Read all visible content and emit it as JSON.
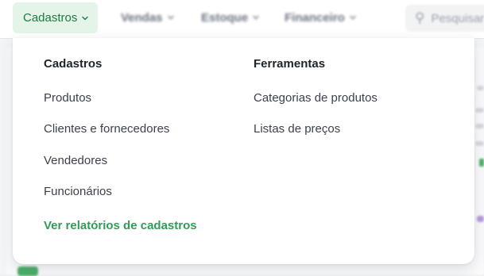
{
  "nav": {
    "items": [
      {
        "label": "Cadastros",
        "active": true
      },
      {
        "label": "Vendas",
        "active": false
      },
      {
        "label": "Estoque",
        "active": false
      },
      {
        "label": "Financeiro",
        "active": false
      }
    ],
    "search_placeholder": "Pesquisar"
  },
  "menu": {
    "col1": {
      "title": "Cadastros",
      "links": [
        "Produtos",
        "Clientes e fornecedores",
        "Vendedores",
        "Funcionários"
      ],
      "report_link": "Ver relatórios de cadastros"
    },
    "col2": {
      "title": "Ferramentas",
      "links": [
        "Categorias de produtos",
        "Listas de preços"
      ]
    }
  },
  "colors": {
    "accent": "#2f9c57",
    "active_tab_bg": "#e4f4e8",
    "active_tab_text": "#1f7a3f"
  }
}
